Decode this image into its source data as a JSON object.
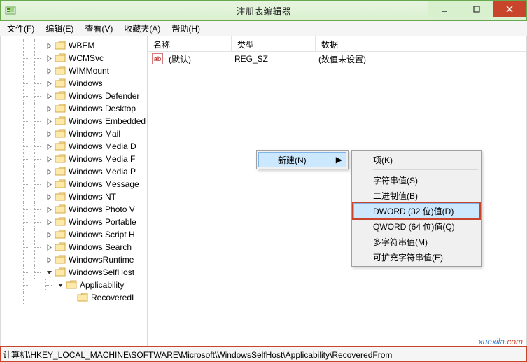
{
  "window": {
    "title": "注册表编辑器"
  },
  "menus": {
    "file": "文件(F)",
    "edit": "编辑(E)",
    "view": "查看(V)",
    "favorites": "收藏夹(A)",
    "help": "帮助(H)"
  },
  "tree": {
    "items": [
      "WBEM",
      "WCMSvc",
      "WIMMount",
      "Windows",
      "Windows Defender",
      "Windows Desktop",
      "Windows Embedded",
      "Windows Mail",
      "Windows Media D",
      "Windows Media F",
      "Windows Media P",
      "Windows Message",
      "Windows NT",
      "Windows Photo V",
      "Windows Portable",
      "Windows Script H",
      "Windows Search",
      "WindowsRuntime"
    ],
    "selfhost": "WindowsSelfHost",
    "applicability": "Applicability",
    "recovered": "RecoveredI"
  },
  "list": {
    "headers": {
      "name": "名称",
      "type": "类型",
      "data": "数据"
    },
    "row": {
      "icon": "ab",
      "name": "(默认)",
      "type": "REG_SZ",
      "data": "(数值未设置)"
    }
  },
  "ctx": {
    "new": "新建(N)",
    "sub": {
      "key": "项(K)",
      "string": "字符串值(S)",
      "binary": "二进制值(B)",
      "dword": "DWORD (32 位)值(D)",
      "qword": "QWORD (64 位)值(Q)",
      "multi": "多字符串值(M)",
      "expand": "可扩充字符串值(E)"
    }
  },
  "status": {
    "path": "计算机\\HKEY_LOCAL_MACHINE\\SOFTWARE\\Microsoft\\WindowsSelfHost\\Applicability\\RecoveredFrom"
  },
  "watermark": {
    "a": "xuexila",
    "b": ".com"
  }
}
